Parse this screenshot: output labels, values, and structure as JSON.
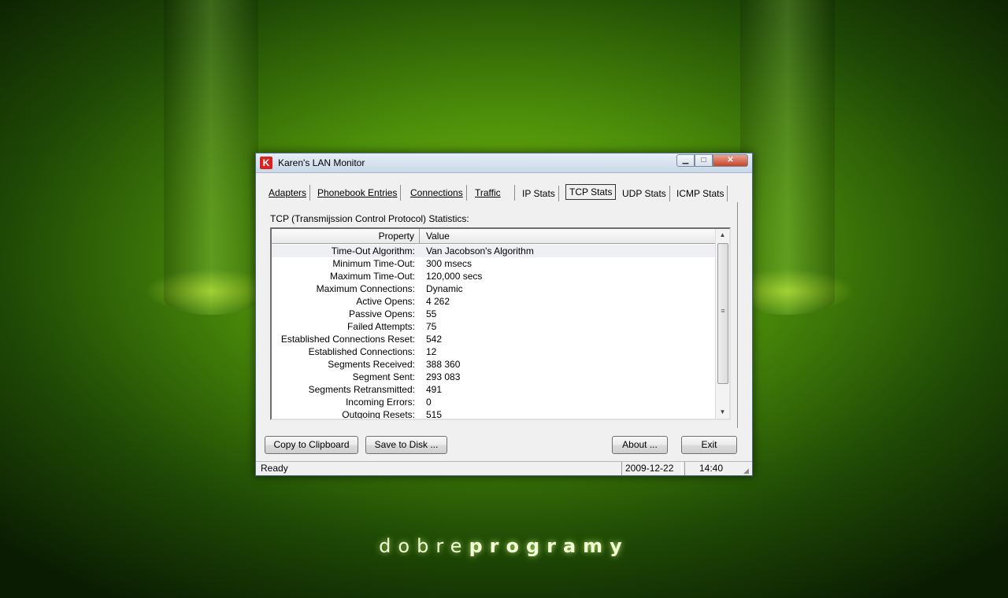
{
  "wallpaper": {
    "brand_light": "dobre",
    "brand_bold": "programy"
  },
  "window": {
    "title": "Karen's LAN Monitor",
    "icon_letter": "K",
    "controls": {
      "minimize": "▁",
      "maximize": "□",
      "close": "✕"
    }
  },
  "tabs": [
    {
      "label": "Adapters"
    },
    {
      "label": "Phonebook Entries"
    },
    {
      "label": "Connections"
    },
    {
      "label": "Traffic"
    },
    {
      "label": "IP Stats"
    },
    {
      "label": "TCP Stats"
    },
    {
      "label": "UDP Stats"
    },
    {
      "label": "ICMP Stats"
    }
  ],
  "active_tab": "TCP Stats",
  "panel": {
    "caption": "TCP (Transmijssion Control Protocol) Statistics:",
    "columns": {
      "property": "Property",
      "value": "Value"
    },
    "rows": [
      {
        "k": "Time-Out Algorithm:",
        "v": "Van Jacobson's Algorithm"
      },
      {
        "k": "Minimum Time-Out:",
        "v": "300 msecs"
      },
      {
        "k": "Maximum Time-Out:",
        "v": "120,000 secs"
      },
      {
        "k": "Maximum Connections:",
        "v": "Dynamic"
      },
      {
        "k": "Active Opens:",
        "v": "4 262"
      },
      {
        "k": "Passive Opens:",
        "v": "55"
      },
      {
        "k": "Failed Attempts:",
        "v": "75"
      },
      {
        "k": "Established Connections Reset:",
        "v": "542"
      },
      {
        "k": "Established Connections:",
        "v": "12"
      },
      {
        "k": "Segments Received:",
        "v": "388 360"
      },
      {
        "k": "Segment Sent:",
        "v": "293 083"
      },
      {
        "k": "Segments Retransmitted:",
        "v": "491"
      },
      {
        "k": "Incoming Errors:",
        "v": "0"
      },
      {
        "k": "Outgoing Resets:",
        "v": "515"
      }
    ],
    "scroll": {
      "up": "▲",
      "down": "▼",
      "grip": "≡"
    }
  },
  "buttons": {
    "copy": "Copy to Clipboard",
    "save": "Save to Disk ...",
    "about": "About ...",
    "exit": "Exit"
  },
  "status": {
    "text": "Ready",
    "date": "2009-12-22",
    "time": "14:40"
  }
}
